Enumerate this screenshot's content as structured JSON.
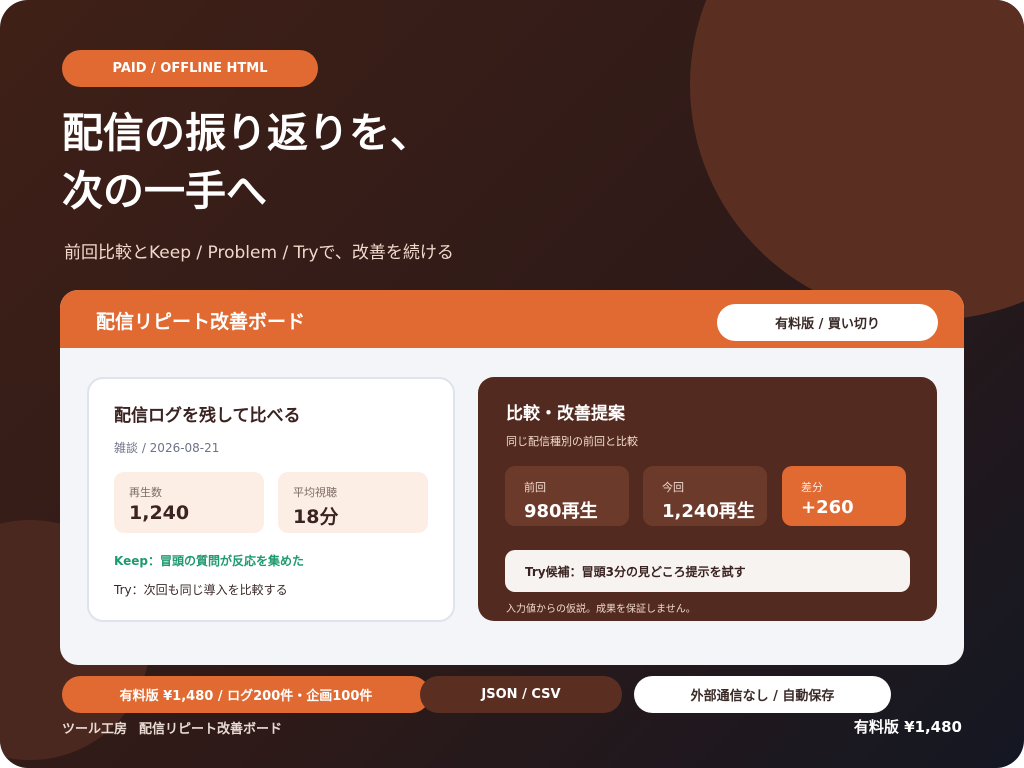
{
  "hero": {
    "badge": "PAID / OFFLINE HTML",
    "headline_line1": "配信の振り返りを、",
    "headline_line2": "次の一手へ",
    "subtitle": "前回比較とKeep / Problem / Tryで、改善を続ける"
  },
  "board": {
    "title": "配信リピート改善ボード",
    "tag": "有料版 / 買い切り",
    "log_card": {
      "title": "配信ログを残して比べる",
      "date": "雑談 / 2026-08-21",
      "stats": [
        {
          "label": "再生数",
          "value": "1,240"
        },
        {
          "label": "平均視聴",
          "value": "18分"
        }
      ],
      "keep": "Keep：冒頭の質問が反応を集めた",
      "try": "Try：次回も同じ導入を比較する"
    },
    "compare_card": {
      "title": "比較・改善提案",
      "subtitle": "同じ配信種別の前回と比較",
      "boxes": [
        {
          "label": "前回",
          "value": "980再生"
        },
        {
          "label": "今回",
          "value": "1,240再生"
        },
        {
          "label": "差分",
          "value": "+260"
        }
      ],
      "try_candidate": "Try候補：冒頭3分の見どころ提示を試す",
      "disclaimer": "入力値からの仮説。成果を保証しません。"
    }
  },
  "chips": {
    "price": "有料版 ¥1,480 / ログ200件・企画100件",
    "formats": "JSON / CSV",
    "offline": "外部通信なし / 自動保存"
  },
  "footer": {
    "brand": "ツール工房",
    "product": "配信リピート改善ボード",
    "price": "有料版 ¥1,480"
  },
  "colors": {
    "accent": "#e06a32",
    "dark_brown": "#532a1f",
    "keep_green": "#1f9a6e"
  }
}
